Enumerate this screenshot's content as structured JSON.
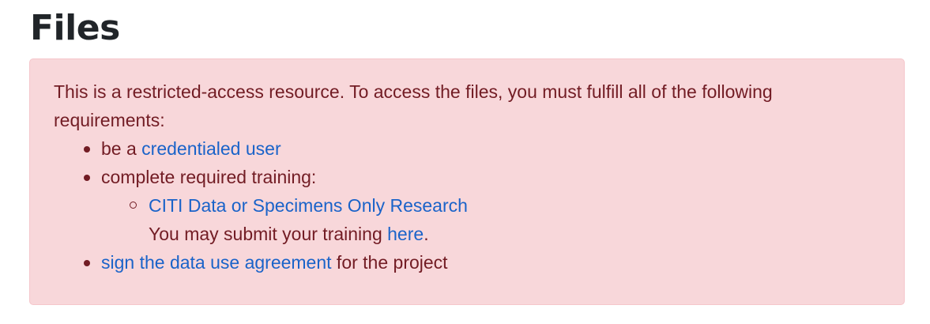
{
  "page": {
    "title": "Files"
  },
  "alert": {
    "intro": "This is a restricted-access resource. To access the files, you must fulfill all of the following requirements:",
    "req1_prefix": "be a ",
    "req1_link": "credentialed user",
    "req2_text": "complete required training:",
    "training_link": "CITI Data or Specimens Only Research",
    "training_note_prefix": "You may submit your training ",
    "training_note_link": "here",
    "training_note_suffix": ".",
    "req3_link": "sign the data use agreement",
    "req3_suffix": " for the project"
  },
  "colors": {
    "alert_background": "#f8d7da",
    "alert_border": "#f5c6cb",
    "alert_text": "#721c24",
    "link": "#1a63c9",
    "title": "#212529"
  }
}
